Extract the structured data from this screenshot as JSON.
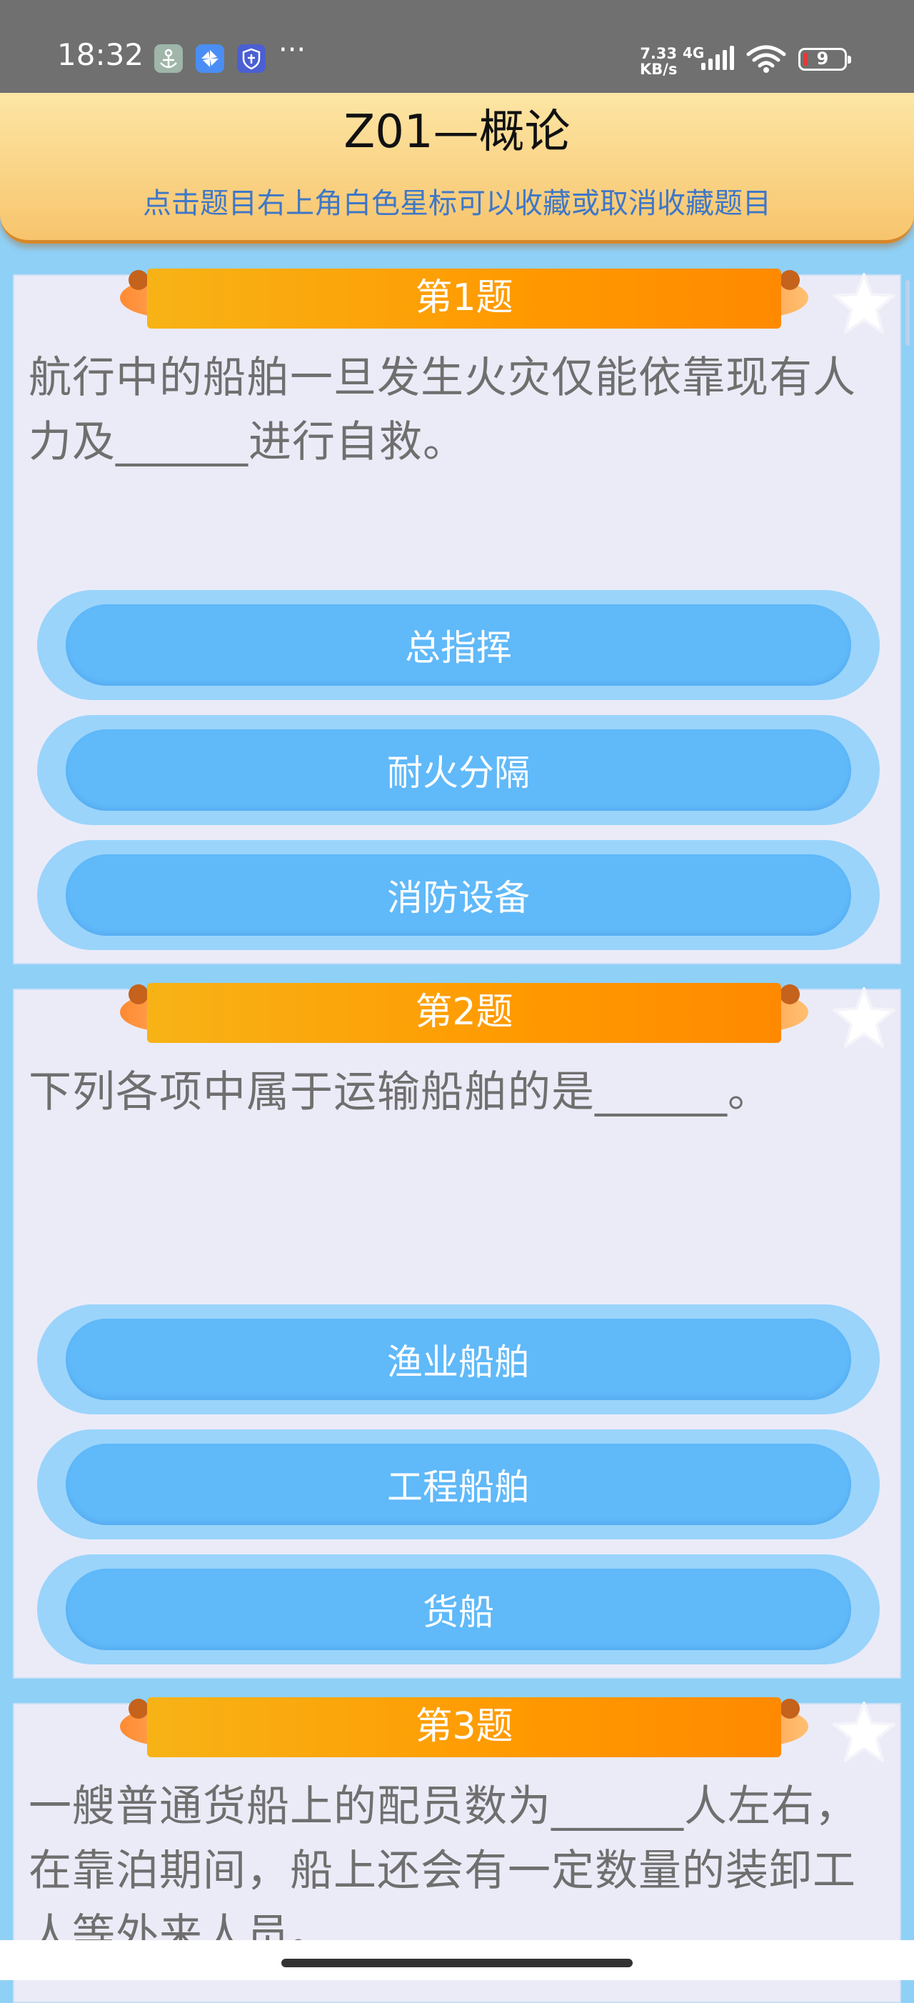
{
  "status_bar": {
    "time": "18:32",
    "more": "···",
    "net_speed_value": "7.33",
    "net_speed_unit": "KB/s",
    "network_type": "4G",
    "battery_level": "9",
    "icons": [
      "anchor-app-icon",
      "fan-app-icon",
      "shield-app-icon",
      "signal-icon",
      "wifi-icon",
      "battery-icon"
    ]
  },
  "header": {
    "title": "Z01—概论",
    "hint": "点击题目右上角白色星标可以收藏或取消收藏题目"
  },
  "questions": [
    {
      "label": "第1题",
      "text": "航行中的船舶一旦发生火灾仅能依靠现有人力及______进行自救。",
      "options": [
        "总指挥",
        "耐火分隔",
        "消防设备"
      ],
      "starred": false
    },
    {
      "label": "第2题",
      "text": "下列各项中属于运输船舶的是______。",
      "options": [
        "渔业船舶",
        "工程船舶",
        "货船"
      ],
      "starred": false
    },
    {
      "label": "第3题",
      "text": "一艘普通货船上的配员数为______人左右，在靠泊期间，船上还会有一定数量的装卸工人等外来人员。",
      "options": [],
      "starred": false
    }
  ],
  "colors": {
    "page_bg": "#8FD0F6",
    "banner": "#FF9900",
    "option": "#60B9F9",
    "hint_text": "#3F77C7"
  }
}
